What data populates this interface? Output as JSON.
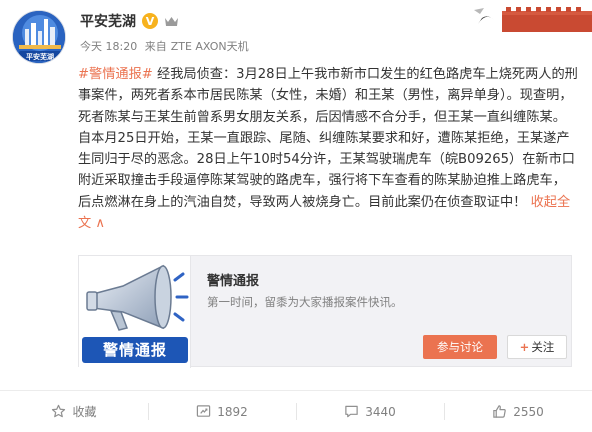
{
  "account": {
    "name": "平安芜湖",
    "verified_badge": "V",
    "time": "今天 18:20",
    "source_prefix": "来自",
    "source": "ZTE AXON天机"
  },
  "post": {
    "tag": "#警情通报#",
    "text": " 经我局侦查：3月28日上午我市新市口发生的红色路虎车上烧死两人的刑事案件，两死者系本市居民陈某（女性，未婚）和王某（男性，离异单身）。现查明，死者陈某与王某生前曾系男女朋友关系，后因情感不合分手，但王某一直纠缠陈某。自本月25日开始，王某一直跟踪、尾随、纠缠陈某要求和好，遭陈某拒绝，王某遂产生同归于尽的恶念。28日上午10时54分许，王某驾驶瑞虎车（皖B09265）在新市口附近采取撞击手段逼停陈某驾驶的路虎车，强行将下车查看的陈某胁迫推上路虎车，后点燃淋在身上的汽油自焚，导致两人被烧身亡。目前此案仍在侦查取证中！",
    "collapse_label": "收起全文",
    "collapse_arrow": "∧"
  },
  "link_card": {
    "thumb_label": "警情通报",
    "title": "警情通报",
    "description": "第一时间，留黍为大家播报案件快讯。",
    "discuss_label": "参与讨论",
    "follow_plus": "+",
    "follow_label": "关注"
  },
  "actions": {
    "favorite_label": "收藏",
    "repost_count": "1892",
    "comment_count": "3440",
    "like_count": "2550"
  },
  "colors": {
    "accent": "#eb7350",
    "meta_gray": "#808080",
    "badge_yellow": "#f7b21e",
    "thumb_blue": "#1d56b6"
  },
  "icons": {
    "favorite": "star-icon",
    "repost": "repost-icon",
    "comment": "comment-icon",
    "like": "thumbs-up-icon",
    "thumb": "megaphone-icon"
  }
}
